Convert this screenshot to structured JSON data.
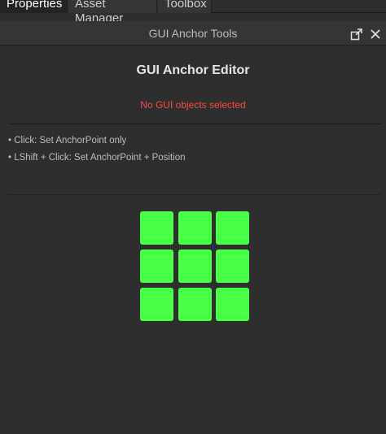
{
  "tabs": [
    {
      "label": "Properties",
      "active": true
    },
    {
      "label": "Asset Manager",
      "active": false
    },
    {
      "label": "Toolbox",
      "active": false
    }
  ],
  "panel": {
    "title": "GUI Anchor Tools",
    "undock_icon": "undock-icon",
    "close_icon": "close-icon"
  },
  "editor": {
    "title": "GUI Anchor Editor",
    "status": "No GUI objects selected",
    "status_color": "#ff4747",
    "hints": [
      "• Click: Set AnchorPoint only",
      "• LShift + Click: Set AnchorPoint + Position"
    ]
  },
  "anchor_grid": {
    "color": "#46ff46",
    "cells": [
      "top-left",
      "top-center",
      "top-right",
      "middle-left",
      "center",
      "middle-right",
      "bottom-left",
      "bottom-center",
      "bottom-right"
    ]
  }
}
